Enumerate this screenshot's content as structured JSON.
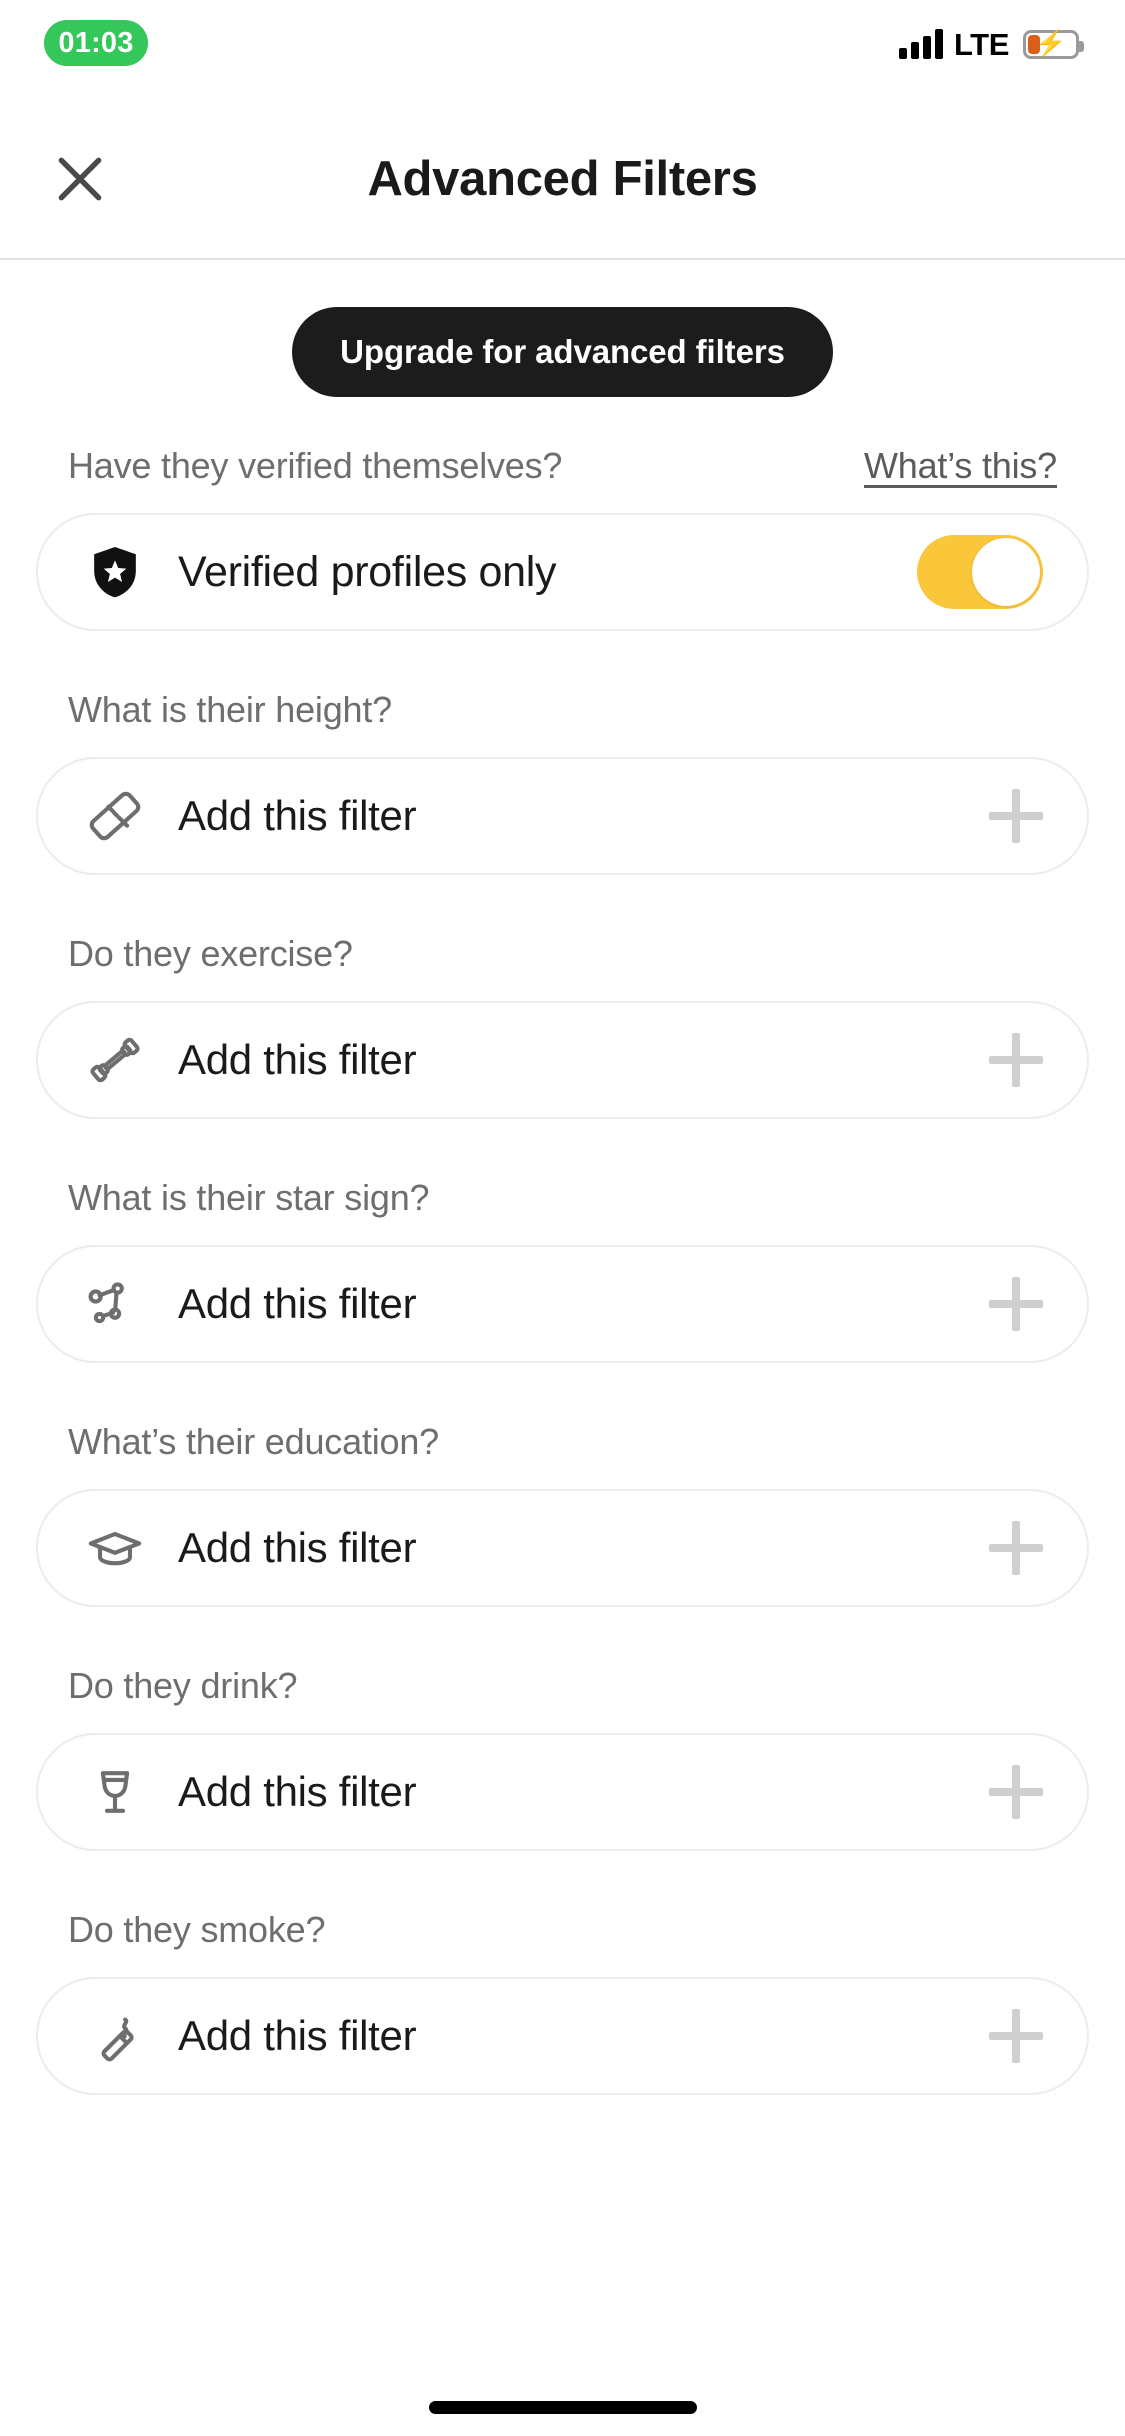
{
  "status_bar": {
    "time": "01:03",
    "time_pill_color": "#34C759",
    "network_label": "LTE",
    "signal_icon": "signal-bars-icon",
    "battery_icon": "battery-charging-icon",
    "battery_fill_color": "#D8601A"
  },
  "header": {
    "close_icon": "close-icon",
    "title": "Advanced Filters"
  },
  "upgrade": {
    "label": "Upgrade for advanced filters",
    "bg_color": "#1C1C1C",
    "text_color": "#FFFFFF"
  },
  "verified_section": {
    "label": "Have they verified themselves?",
    "help_link": "What’s this?",
    "row": {
      "icon": "shield-star-icon",
      "label": "Verified profiles only",
      "toggle_state": "on",
      "toggle_color": "#FAC63A"
    }
  },
  "filters": [
    {
      "question": "What is their height?",
      "icon": "ruler-icon",
      "action_label": "Add this filter",
      "action_icon": "plus-icon"
    },
    {
      "question": "Do they exercise?",
      "icon": "dumbbell-icon",
      "action_label": "Add this filter",
      "action_icon": "plus-icon"
    },
    {
      "question": "What is their star sign?",
      "icon": "constellation-icon",
      "action_label": "Add this filter",
      "action_icon": "plus-icon"
    },
    {
      "question": "What’s their education?",
      "icon": "graduation-cap-icon",
      "action_label": "Add this filter",
      "action_icon": "plus-icon"
    },
    {
      "question": "Do they drink?",
      "icon": "wine-glass-icon",
      "action_label": "Add this filter",
      "action_icon": "plus-icon"
    },
    {
      "question": "Do they smoke?",
      "icon": "cigarette-icon",
      "action_label": "Add this filter",
      "action_icon": "plus-icon"
    }
  ],
  "home_indicator": "home-indicator"
}
